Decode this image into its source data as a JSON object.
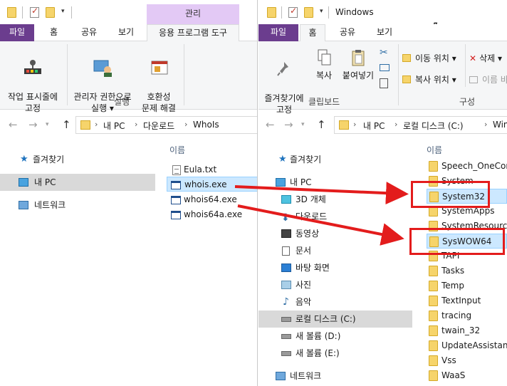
{
  "left_window": {
    "ctx_tab_header": "관리",
    "ribbon_tabs": {
      "file": "파일",
      "home": "홈",
      "share": "공유",
      "view": "보기",
      "app_tools": "응용 프로그램 도구"
    },
    "ribbon": {
      "pin_taskbar": "작업 표시줄에\n고정",
      "run_admin": "관리자 권한으로\n실행 ▾",
      "compat": "호환성\n문제 해결",
      "group_run": "실행"
    },
    "breadcrumb": [
      "내 PC",
      "다운로드",
      "WhoIs"
    ],
    "nav": {
      "favorites": "즐겨찾기",
      "this_pc": "내 PC",
      "network": "네트워크"
    },
    "column_name": "이름",
    "files": [
      "Eula.txt",
      "whois.exe",
      "whois64.exe",
      "whois64a.exe"
    ]
  },
  "right_window": {
    "title": "Windows",
    "ribbon_tabs": {
      "file": "파일",
      "home": "홈",
      "share": "공유",
      "view": "보기"
    },
    "ribbon": {
      "pin_quick": "즐겨찾기에\n고정",
      "copy": "복사",
      "paste": "붙여넣기",
      "move_to": "이동 위치 ▾",
      "copy_to": "복사 위치 ▾",
      "delete": "삭제 ▾",
      "rename": "이름 바",
      "group_clipboard": "클립보드",
      "group_organize": "구성"
    },
    "breadcrumb": [
      "내 PC",
      "로컬 디스크 (C:)",
      "Window"
    ],
    "nav": [
      {
        "label": "즐겨찾기",
        "icon": "star-icon"
      },
      {
        "label": "내 PC",
        "icon": "computer-icon"
      },
      {
        "label": "3D 개체",
        "icon": "cube-icon"
      },
      {
        "label": "다운로드",
        "icon": "download-icon"
      },
      {
        "label": "동영상",
        "icon": "video-icon"
      },
      {
        "label": "문서",
        "icon": "document-icon"
      },
      {
        "label": "바탕 화면",
        "icon": "desktop-icon"
      },
      {
        "label": "사진",
        "icon": "picture-icon"
      },
      {
        "label": "음악",
        "icon": "music-icon"
      },
      {
        "label": "로컬 디스크 (C:)",
        "icon": "drive-icon"
      },
      {
        "label": "새 볼륨 (D:)",
        "icon": "drive-icon"
      },
      {
        "label": "새 볼륨 (E:)",
        "icon": "drive-icon"
      },
      {
        "label": "네트워크",
        "icon": "network-icon"
      }
    ],
    "column_name": "이름",
    "folders": [
      "Speech_OneCore",
      "System",
      "System32",
      "SystemApps",
      "SystemResources",
      "SysWOW64",
      "TAPI",
      "Tasks",
      "Temp",
      "TextInput",
      "tracing",
      "twain_32",
      "UpdateAssistantV",
      "Vss",
      "WaaS"
    ]
  },
  "colors": {
    "annotation": "#e31c1c",
    "file_tab": "#6b3d8e",
    "context_tab": "#e3c9f5",
    "selection": "#cce8ff"
  }
}
